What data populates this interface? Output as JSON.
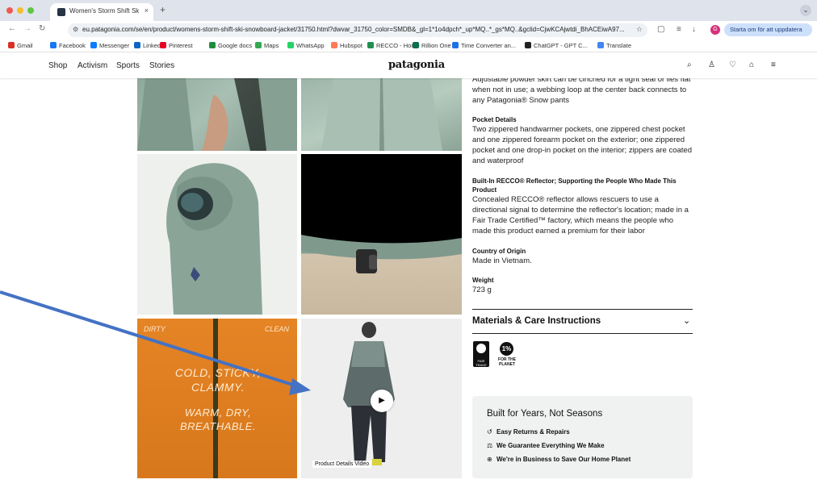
{
  "browser": {
    "tab_title": "Women's Storm Shift Ski/Sno",
    "tab_close": "×",
    "new_tab": "+",
    "tab_menu": "⌄",
    "url": "eu.patagonia.com/se/en/product/womens-storm-shift-ski-snowboard-jacket/31750.html?dwvar_31750_color=SMDB&_gl=1*1o4dpch*_up*MQ..*_gs*MQ..&gclid=CjwKCAjwtdi_BhACEiwA97...",
    "update_label": "Starta om för att uppdatera",
    "avatar_letter": "G",
    "bookmarks": [
      "Gmail",
      "Facebook",
      "Messenger",
      "LinkedIn",
      "Pinterest",
      "Google docs",
      "Maps",
      "WhatsApp",
      "Hubspot",
      "RECCO - Home",
      "Rillion One",
      "Time Converter an...",
      "ChatGPT - GPT C...",
      "Translate"
    ],
    "bookmark_colors": [
      "#d93025",
      "#1877f2",
      "#0a7cff",
      "#0a66c2",
      "#e60023",
      "#1e8e3e",
      "#34a853",
      "#25d366",
      "#ff7a59",
      "#1f8f4e",
      "#0b6e4f",
      "#1a73e8",
      "#202123",
      "#4285f4"
    ]
  },
  "header": {
    "nav": [
      "Shop",
      "Activism",
      "Sports",
      "Stories"
    ],
    "logo": "patagonia"
  },
  "images": {
    "dirty": "DIRTY",
    "clean": "CLEAN",
    "claim_top": "COLD, STICKY, CLAMMY.",
    "claim_bottom": "WARM, DRY, BREATHABLE.",
    "video_caption": "Product Details Video"
  },
  "details": {
    "clipped_text": "Adjustable powder skirt can be cinched for a tight seal or lies flat when not in use; a webbing loop at the center back connects to any Patagonia® Snow pants",
    "pocket_heading": "Pocket Details",
    "pocket_text": "Two zippered handwarmer pockets, one zippered chest pocket and one zippered forearm pocket on the exterior; one zippered pocket and one drop-in pocket on the interior; zippers are coated and waterproof",
    "recco_heading": "Built-In RECCO® Reflector; Supporting the People Who Made This Product",
    "recco_text": "Concealed RECCO® reflector allows rescuers to use a directional signal to determine the reflector's location; made in a Fair Trade Certified™ factory, which means the people who made this product earned a premium for their labor",
    "origin_heading": "Country of Origin",
    "origin_text": "Made in Vietnam.",
    "weight_heading": "Weight",
    "weight_text": "723 g"
  },
  "materials": {
    "title": "Materials & Care Instructions",
    "fair_trade_badge": "FAIR TRADE CERTIFIED FACTORY",
    "planet_number": "1%",
    "planet_label": "FOR THE PLANET"
  },
  "built": {
    "title": "Built for Years, Not Seasons",
    "items": [
      "Easy Returns & Repairs",
      "We Guarantee Everything We Make",
      "We're in Business to Save Our Home Planet"
    ]
  },
  "icons": {
    "header": [
      "search-icon",
      "account-icon",
      "wishlist-icon",
      "cart-icon",
      "menu-icon"
    ],
    "built": [
      "return-icon",
      "guarantee-icon",
      "planet-icon"
    ]
  },
  "colors": {
    "jacket_green": "#8ea99c",
    "orange_panel": "#e58425",
    "annotation_arrow": "#4472c4"
  }
}
